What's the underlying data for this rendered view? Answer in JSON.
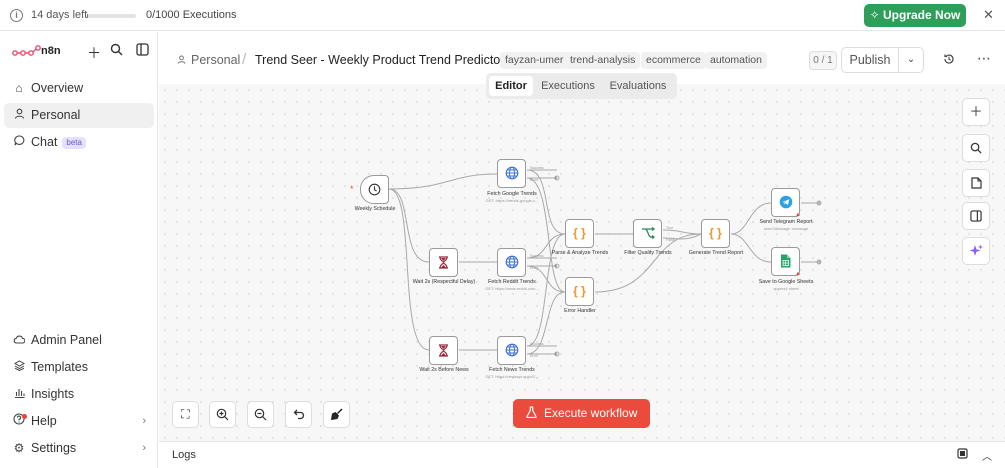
{
  "trial": {
    "days_left": "14 days left",
    "executions": "0/1000 Executions",
    "progress": 0.02
  },
  "upgrade": {
    "label": "Upgrade Now",
    "icon": "sparkle-icon"
  },
  "sidebar": {
    "brand": "n8n",
    "nav": [
      {
        "label": "Overview",
        "icon": "home-icon"
      },
      {
        "label": "Personal",
        "icon": "user-icon"
      },
      {
        "label": "Chat",
        "icon": "chat-icon",
        "badge": "beta"
      }
    ],
    "bottom": [
      {
        "label": "Admin Panel",
        "icon": "cloud-icon"
      },
      {
        "label": "Templates",
        "icon": "templates-icon"
      },
      {
        "label": "Insights",
        "icon": "insights-icon"
      },
      {
        "label": "Help",
        "icon": "help-icon"
      },
      {
        "label": "Settings",
        "icon": "settings-icon"
      }
    ]
  },
  "header": {
    "personal": "Personal",
    "title": "Trend Seer - Weekly Product Trend Predictor",
    "tags": [
      "fayzan-umer",
      "trend-analysis",
      "ecommerce",
      "automation"
    ],
    "counter": "0 / 1",
    "publish": "Publish"
  },
  "tabs": [
    "Editor",
    "Executions",
    "Evaluations"
  ],
  "nodes": {
    "schedule": {
      "label": "Weekly Schedule"
    },
    "google": {
      "label": "Fetch Google Trends",
      "sub": "GET: https://trends.google.c..."
    },
    "reddit_wait": {
      "label": "Wait 2s (Respectful Delay)"
    },
    "reddit": {
      "label": "Fetch Reddit Trends",
      "sub": "GET: https://www.reddit.com..."
    },
    "news_wait": {
      "label": "Wait 2s Before News"
    },
    "news": {
      "label": "Fetch News Trends",
      "sub": "GET: https://newsapi.org/v2/..."
    },
    "parse": {
      "label": "Parse & Analyze Trends"
    },
    "error": {
      "label": "Error Handler"
    },
    "filter": {
      "label": "Filter Quality Trends"
    },
    "report": {
      "label": "Generate Trend Report"
    },
    "telegram": {
      "label": "Send Telegram Report",
      "sub": "send Message: message"
    },
    "sheets": {
      "label": "Save to Google Sheets",
      "sub": "append: sheet"
    }
  },
  "edge_labels": {
    "success": "Success",
    "error": "Error",
    "true": "True",
    "false": "False"
  },
  "canvas": {
    "execute": "Execute workflow"
  },
  "logs": {
    "label": "Logs"
  }
}
